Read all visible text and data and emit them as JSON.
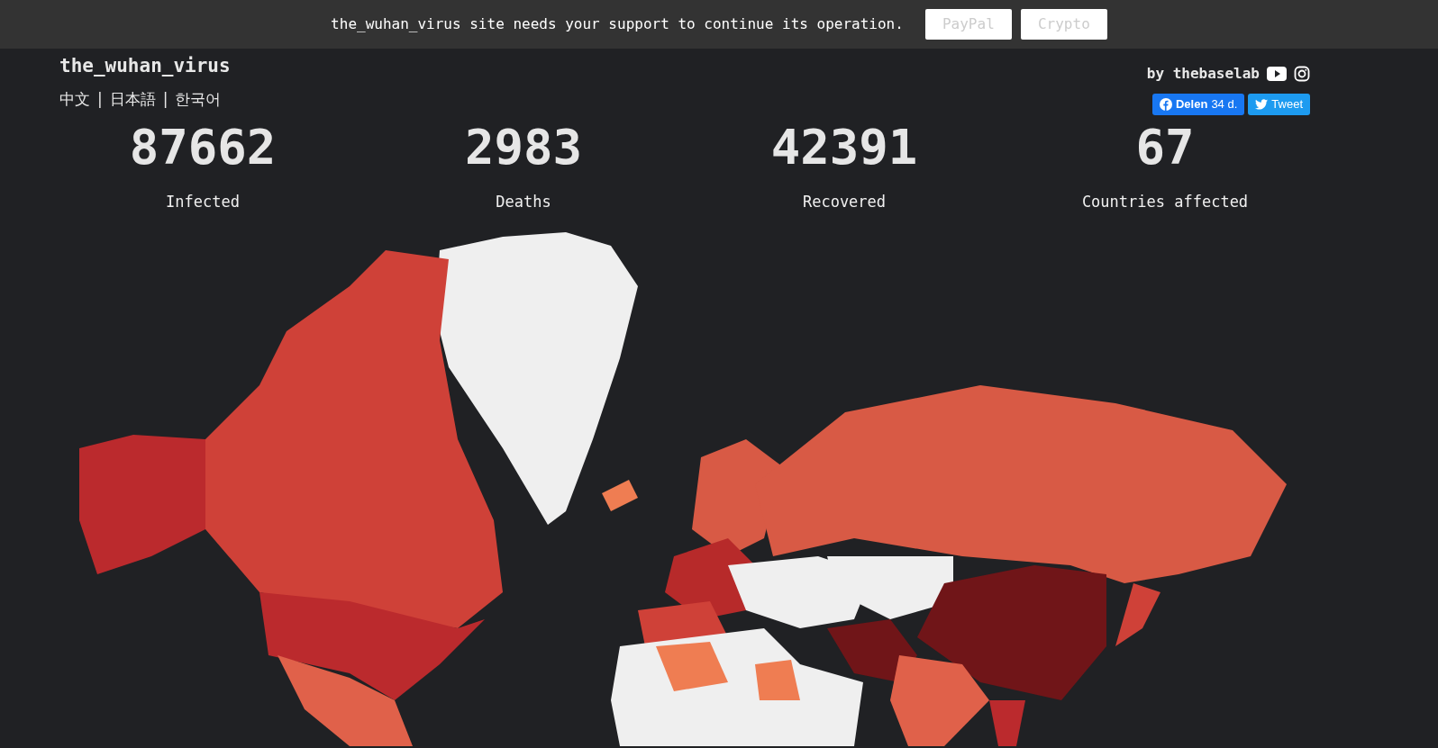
{
  "banner": {
    "message": "the_wuhan_virus site needs your support to continue its operation.",
    "buttons": [
      "PayPal",
      "Crypto"
    ]
  },
  "header": {
    "title": "the_wuhan_virus",
    "languages": [
      "中文",
      "日本語",
      "한국어"
    ],
    "separator": "|",
    "author": "by thebaselab",
    "share_button": {
      "label": "Delen",
      "count": "34 d."
    },
    "tweet_button": {
      "label": "Tweet"
    }
  },
  "stats": [
    {
      "value": "87662",
      "label": "Infected"
    },
    {
      "value": "2983",
      "label": "Deaths"
    },
    {
      "value": "42391",
      "label": "Recovered"
    },
    {
      "value": "67",
      "label": "Countries affected"
    }
  ]
}
